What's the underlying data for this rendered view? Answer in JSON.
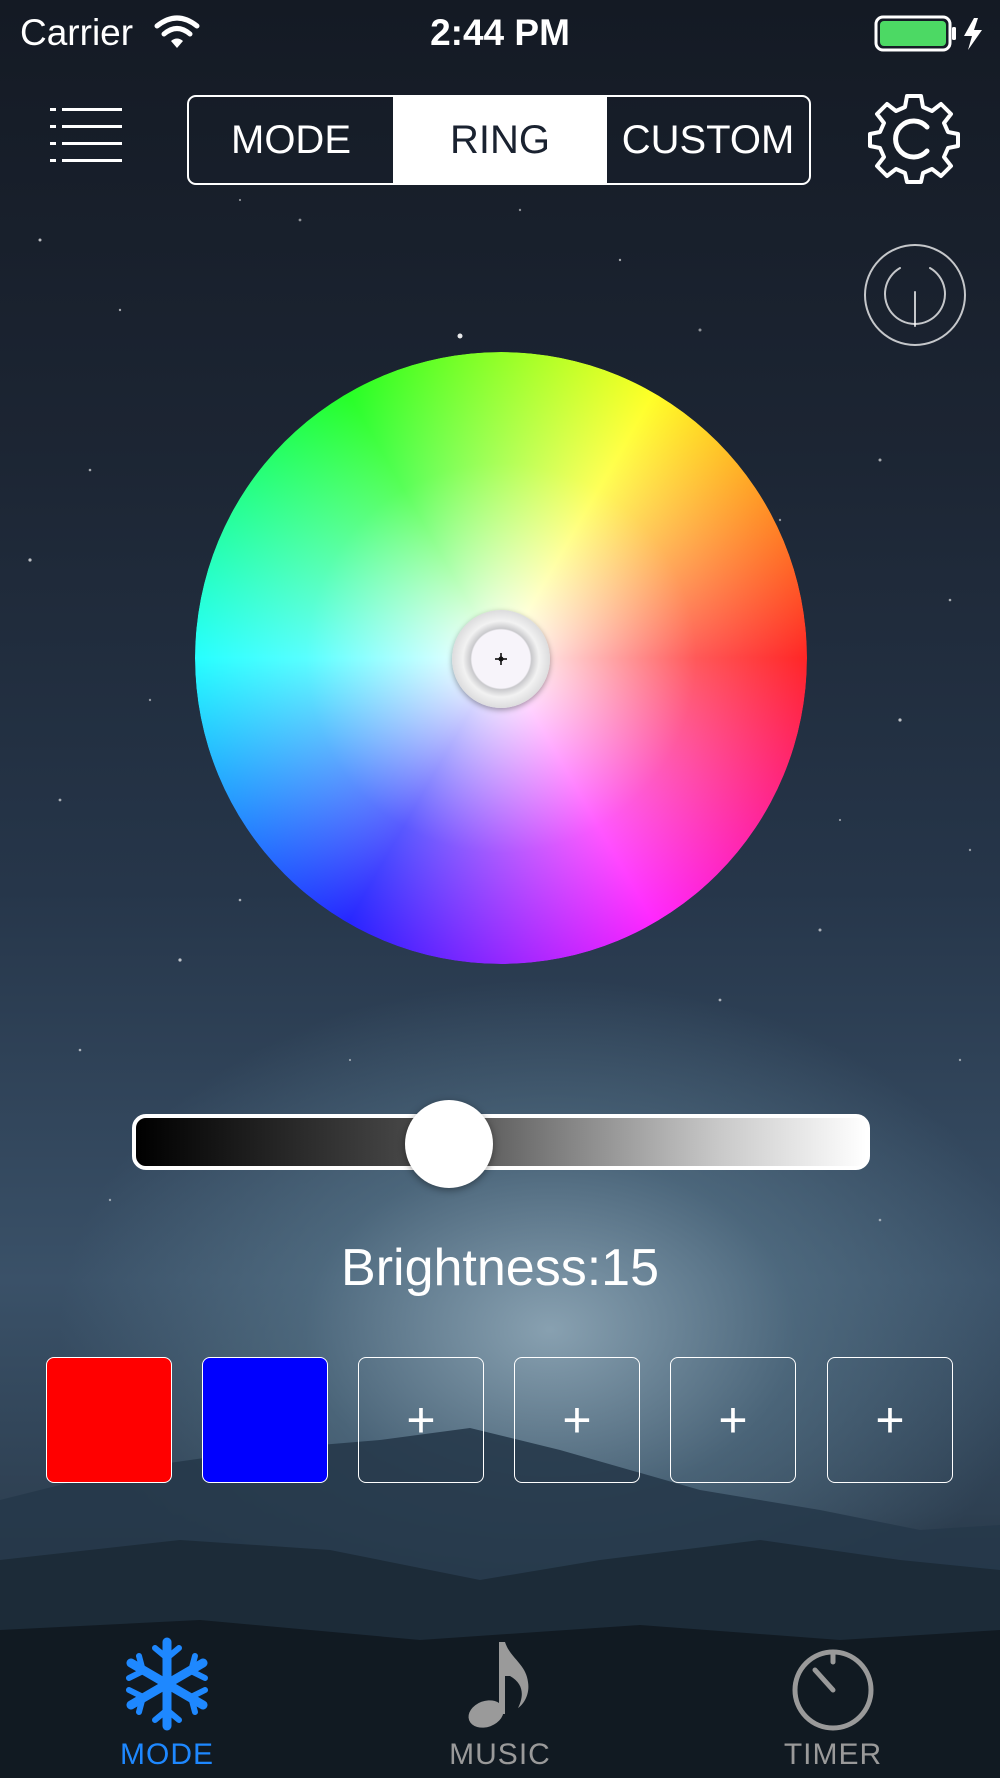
{
  "status_bar": {
    "carrier": "Carrier",
    "time": "2:44 PM",
    "battery_color": "#4cd964"
  },
  "header": {
    "menu_icon": "list-icon",
    "settings_icon": "gear-icon",
    "segments": [
      {
        "label": "MODE",
        "selected": false
      },
      {
        "label": "RING",
        "selected": true
      },
      {
        "label": "CUSTOM",
        "selected": false
      }
    ]
  },
  "power": {
    "icon": "power-icon"
  },
  "color_wheel": {
    "hues": [
      "#ff0000",
      "#ff00ff",
      "#0000ff",
      "#00ffff",
      "#00ff00",
      "#ffff00"
    ],
    "selected_color": "#ffffff"
  },
  "brightness": {
    "label": "Brightness:15",
    "value": 15,
    "level": 0.43
  },
  "swatches": [
    {
      "type": "color",
      "color": "#ff0000",
      "label": ""
    },
    {
      "type": "color",
      "color": "#0000ff",
      "label": ""
    },
    {
      "type": "add",
      "color": "",
      "label": "+"
    },
    {
      "type": "add",
      "color": "",
      "label": "+"
    },
    {
      "type": "add",
      "color": "",
      "label": "+"
    },
    {
      "type": "add",
      "color": "",
      "label": "+"
    }
  ],
  "tabbar": {
    "active_color": "#1e88ff",
    "inactive_color": "#9a9a9a",
    "tabs": [
      {
        "label": "MODE",
        "icon": "snowflake-icon",
        "active": true
      },
      {
        "label": "MUSIC",
        "icon": "music-note-icon",
        "active": false
      },
      {
        "label": "TIMER",
        "icon": "timer-icon",
        "active": false
      }
    ]
  }
}
